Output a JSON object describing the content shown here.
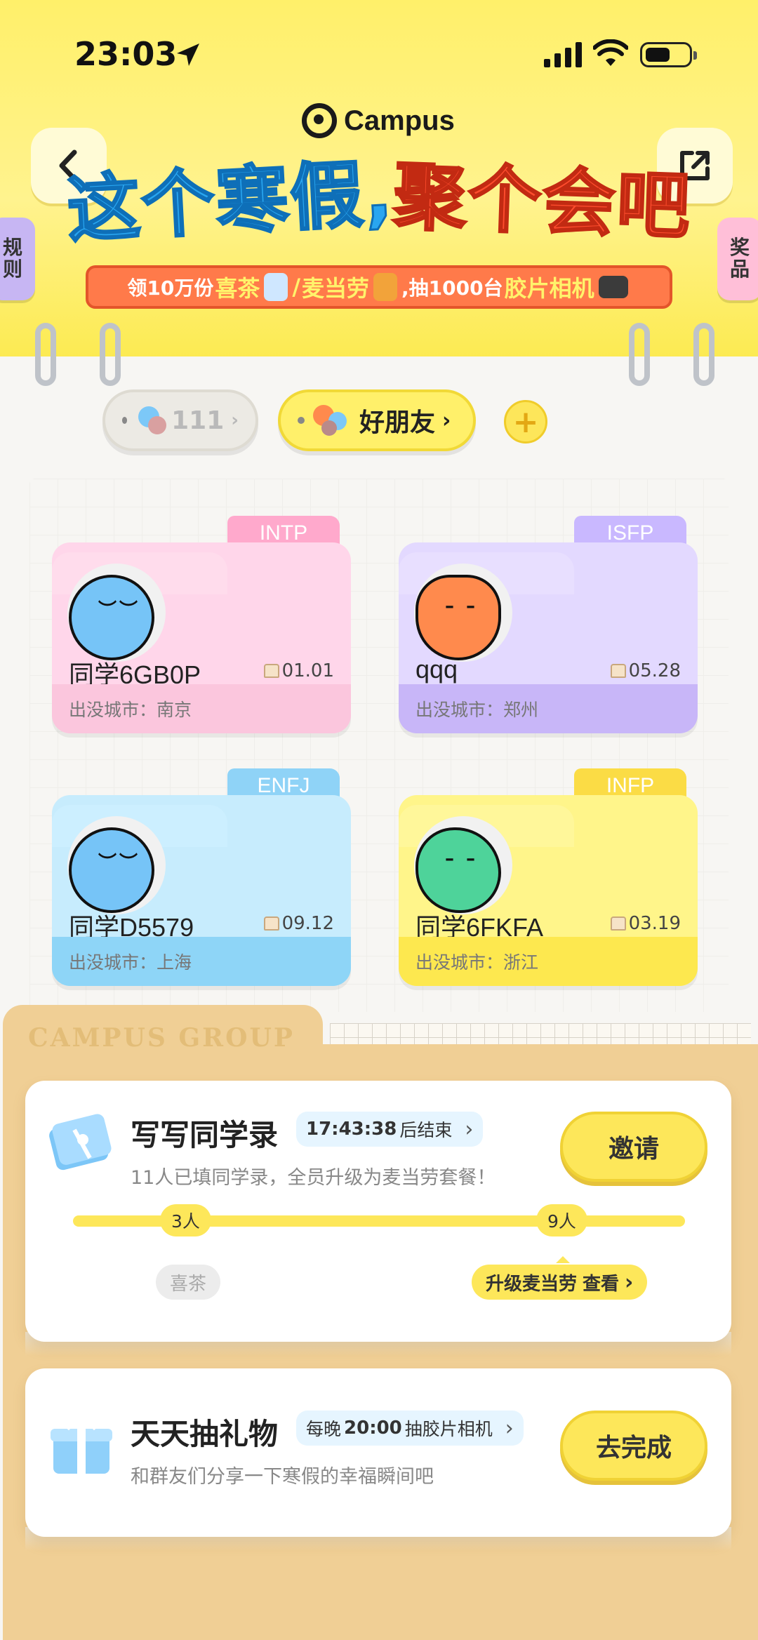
{
  "status_bar": {
    "time": "23:03"
  },
  "header": {
    "logo_text": "Campus",
    "title_part1": "这个寒假,",
    "title_part2": "聚个会吧",
    "ribbon": {
      "t1": "领10万份",
      "hl1": "喜茶",
      "t2": "/",
      "hl2": "麦当劳",
      "t3": ",抽1000台",
      "hl3": "胶片相机"
    },
    "rules_tab": "规\n则",
    "prize_tab": "奖\n品"
  },
  "groups": [
    {
      "label": "111"
    },
    {
      "label": "好朋友"
    }
  ],
  "cards": [
    {
      "mbti": "INTP",
      "name": "同学6GB0P",
      "birthday": "01.01",
      "city": "出没城市：南京",
      "theme": "pink"
    },
    {
      "mbti": "ISFP",
      "name": "qqq",
      "birthday": "05.28",
      "city": "出没城市：郑州",
      "theme": "purple"
    },
    {
      "mbti": "ENFJ",
      "name": "同学D5579",
      "birthday": "09.12",
      "city": "出没城市：上海",
      "theme": "blue"
    },
    {
      "mbti": "INFP",
      "name": "同学6FKFA",
      "birthday": "03.19",
      "city": "出没城市：浙江",
      "theme": "yellow"
    }
  ],
  "folder_label": "CAMPUS GROUP",
  "task1": {
    "title": "写写同学录",
    "timer": "17:43:38",
    "timer_suffix": "后结束",
    "desc": "11人已填同学录，全员升级为麦当劳套餐！",
    "button": "邀请",
    "node1": "3人",
    "node2": "9人",
    "reward1": "喜茶",
    "reward2": "升级麦当劳",
    "reward2_link": "查看"
  },
  "task2": {
    "title": "天天抽礼物",
    "chip_pre": "每晚",
    "chip_time": "20:00",
    "chip_post": "抽胶片相机",
    "desc": "和群友们分享一下寒假的幸福瞬间吧",
    "button": "去完成"
  },
  "colors": {
    "accent_yellow": "#fde75a",
    "blue_title": "#29a6f0",
    "red_title": "#ff4d2e",
    "folder": "#f0cf95"
  }
}
